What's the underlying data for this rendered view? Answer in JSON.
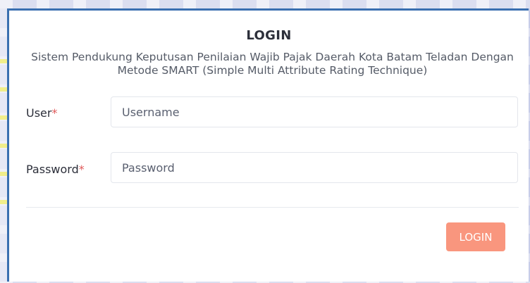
{
  "login": {
    "title": "LOGIN",
    "subtitle": "Sistem Pendukung Keputusan Penilaian Wajib Pajak Daerah Kota Batam Teladan Dengan Metode SMART (Simple Multi Attribute Rating Technique)",
    "user_label": "User",
    "password_label": "Password",
    "required_mark": "*",
    "username_placeholder": "Username",
    "password_placeholder": "Password",
    "submit_label": "LOGIN"
  },
  "colors": {
    "background": "#c7cde8",
    "card": "#ffffff",
    "border_accent": "#3a6fb0",
    "required": "#e05a5a",
    "button": "#f9967e"
  }
}
